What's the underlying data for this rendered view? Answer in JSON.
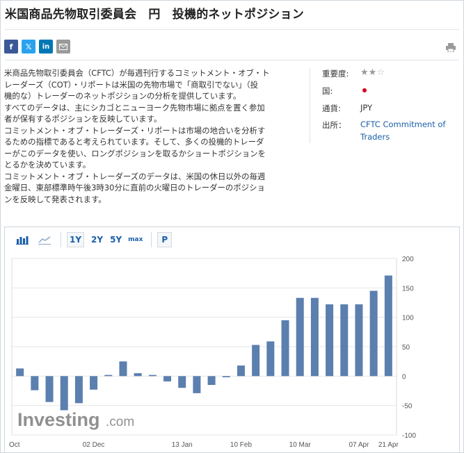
{
  "page": {
    "title": "米国商品先物取引委員会　円　投機的ネットポジション"
  },
  "share": {
    "facebook": "f",
    "twitter": "𝕏",
    "linkedin": "in",
    "email_icon": "envelope-icon",
    "print_icon": "printer-icon"
  },
  "description": {
    "lines": [
      "米商品先物取引委員会（CFTC）が毎週刊行するコミットメント・オブ・ト",
      "レーダーズ（COT）・リポートは米国の先物市場で「商取引でない」（投",
      "機的な）トレーダーのネットポジションの分析を提供しています。",
      "すべてのデータは、主にシカゴとニューヨーク先物市場に拠点を置く参加",
      "者が保有するポジションを反映しています。",
      "コミットメント・オブ・トレーダーズ・リポートは市場の地合いを分析す",
      "るための指標であると考えられています。そして、多くの投機的トレーダ",
      "ーがこのデータを使い、ロングポジションを取るかショートポジションを",
      "とるかを決めています。",
      "コミットメント・オブ・トレーダーズのデータは、米国の休日以外の毎週",
      "金曜日、東部標準時午後3時30分に直前の火曜日のトレーダーのポジショ",
      "ンを反映して発表されます。"
    ]
  },
  "info": {
    "importance_label": "重要度:",
    "importance_stars": 2,
    "importance_max": 3,
    "country_label": "国:",
    "country_flag": "japan-flag-icon",
    "currency_label": "通貨:",
    "currency_value": "JPY",
    "source_label": "出所：",
    "source_line1": "CFTC Commitment of",
    "source_line2": "Traders"
  },
  "toolbar": {
    "bar_icon": "bar-chart-icon",
    "line_icon": "line-chart-icon",
    "range_1y": "1Y",
    "range_2y": "2Y",
    "range_5y": "5Y",
    "range_max": "max",
    "p_button": "P",
    "selected_range": "1Y"
  },
  "watermark": {
    "brand": "Investing",
    "suffix": ".com"
  },
  "colors": {
    "bar": "#5b7fae",
    "link": "#1a5fa8",
    "grid": "#e6e6e6"
  },
  "chart_data": {
    "type": "bar",
    "ylim": [
      -100,
      200
    ],
    "yticks": [
      -100,
      -50,
      0,
      50,
      100,
      150,
      200
    ],
    "x_tick_labels": [
      "Oct",
      "02 Dec",
      "13 Jan",
      "10 Feb",
      "10 Mar",
      "07 Apr",
      "21 Apr"
    ],
    "x_tick_bar_index": [
      0,
      5,
      11,
      15,
      19,
      23,
      25
    ],
    "values": [
      13,
      -24,
      -44,
      -58,
      -46,
      -23,
      2,
      25,
      5,
      2,
      -9,
      -20,
      -29,
      -15,
      -2,
      18,
      53,
      59,
      95,
      133,
      133,
      122,
      122,
      122,
      145,
      171
    ],
    "grid": true
  }
}
